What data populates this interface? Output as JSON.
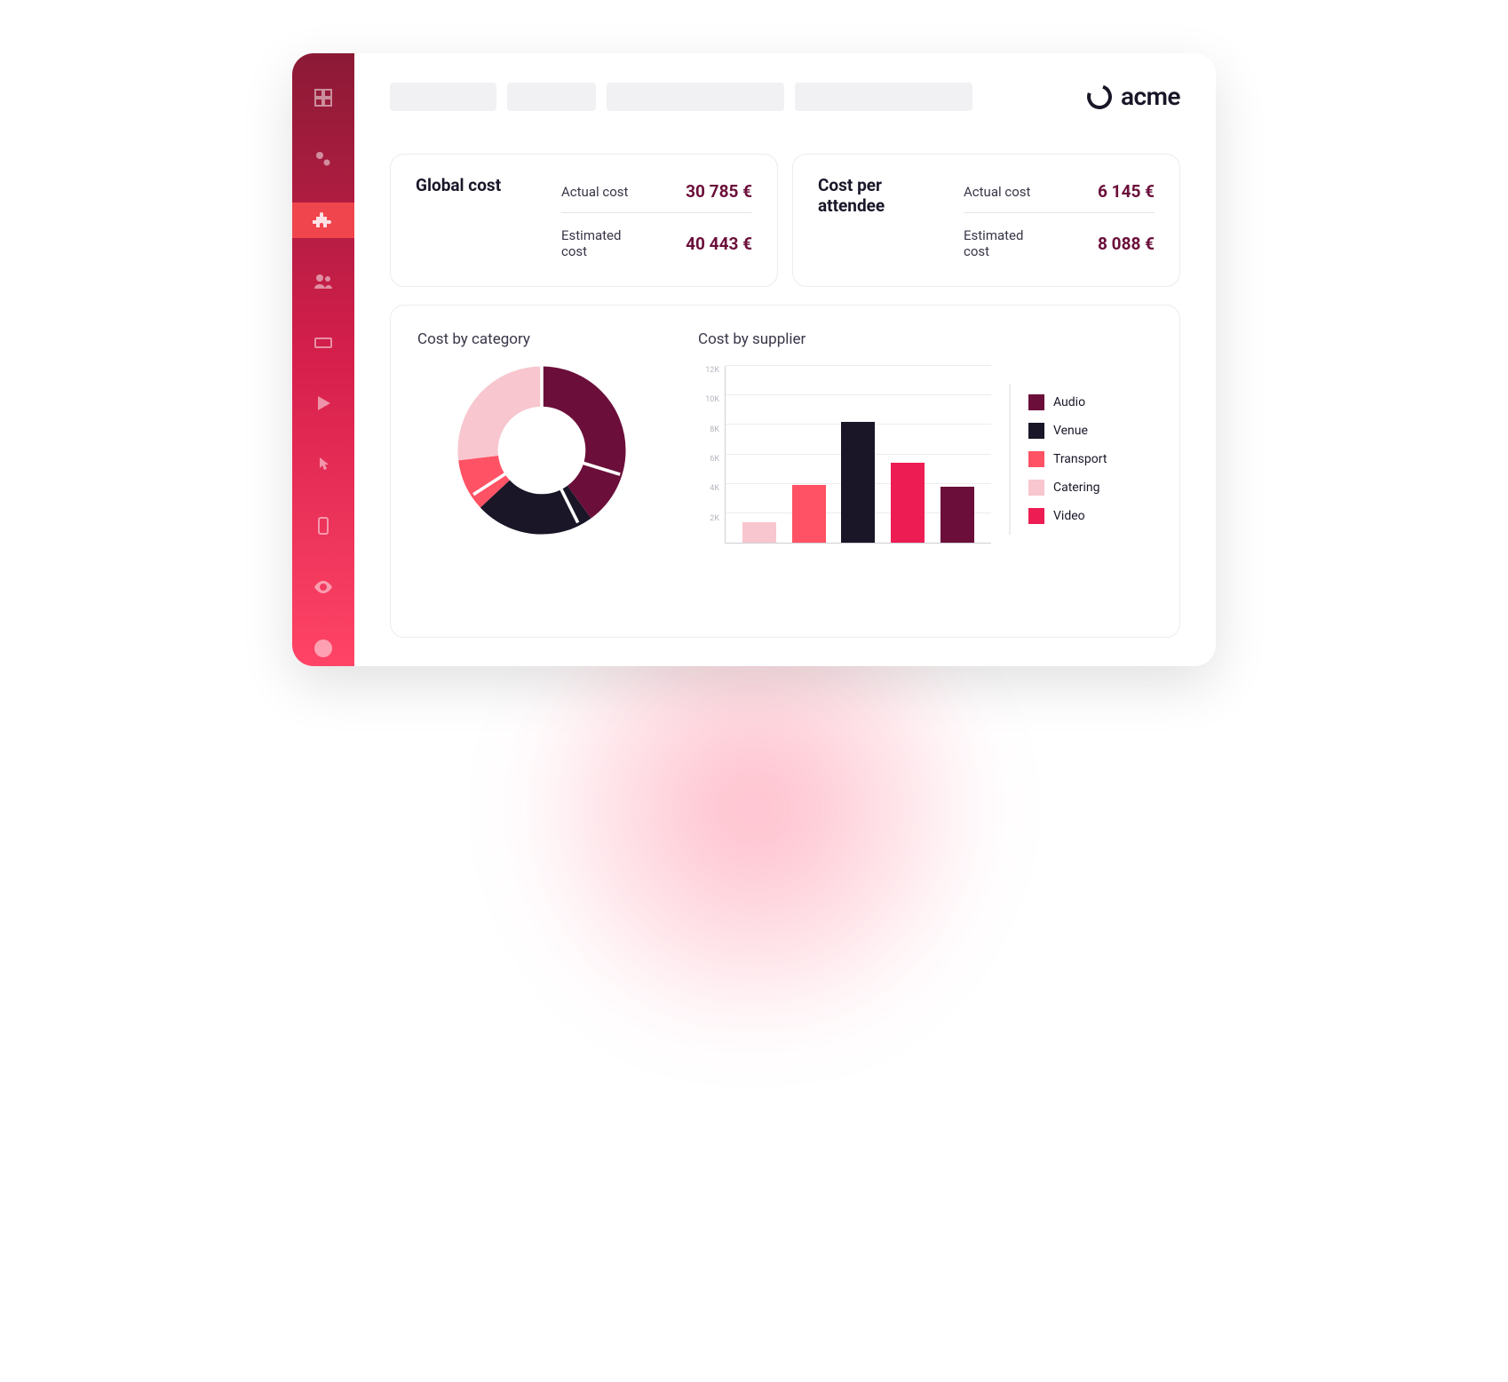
{
  "brand": {
    "name": "acme"
  },
  "stats": {
    "global": {
      "title": "Global cost",
      "actual_label": "Actual cost",
      "actual_value": "30 785 €",
      "estimated_label": "Estimated cost",
      "estimated_value": "40 443 €"
    },
    "per_attendee": {
      "title": "Cost per attendee",
      "actual_label": "Actual cost",
      "actual_value": "6 145 €",
      "estimated_label": "Estimated cost",
      "estimated_value": "8 088 €"
    }
  },
  "charts": {
    "category_title": "Cost by category",
    "supplier_title": "Cost by supplier",
    "y_ticks": {
      "t0": "12K",
      "t1": "10K",
      "t2": "8K",
      "t3": "6K",
      "t4": "4K",
      "t5": "2K"
    },
    "legend": {
      "audio": "Audio",
      "venue": "Venue",
      "transport": "Transport",
      "catering": "Catering",
      "video": "Video"
    }
  },
  "chart_data": [
    {
      "type": "pie",
      "title": "Cost by category",
      "series": [
        {
          "name": "Audio",
          "value": 40,
          "color": "#6b0f3a"
        },
        {
          "name": "Venue",
          "value": 23,
          "color": "#1a1628"
        },
        {
          "name": "Transport",
          "value": 10,
          "color": "#ff5264"
        },
        {
          "name": "Catering",
          "value": 27,
          "color": "#f8c6ce"
        }
      ]
    },
    {
      "type": "bar",
      "title": "Cost by supplier",
      "categories": [
        "Catering",
        "Transport",
        "Venue",
        "Video",
        "Audio"
      ],
      "values": [
        1400,
        3900,
        8200,
        5400,
        3800
      ],
      "colors": [
        "#f8c6ce",
        "#ff5264",
        "#1a1628",
        "#ed1c52",
        "#6b0f3a"
      ],
      "ylim": [
        0,
        12000
      ],
      "ylabel": "",
      "xlabel": ""
    }
  ],
  "colors": {
    "audio": "#6b0f3a",
    "venue": "#1a1628",
    "transport": "#ff5264",
    "catering": "#f8c6ce",
    "video": "#ed1c52"
  }
}
